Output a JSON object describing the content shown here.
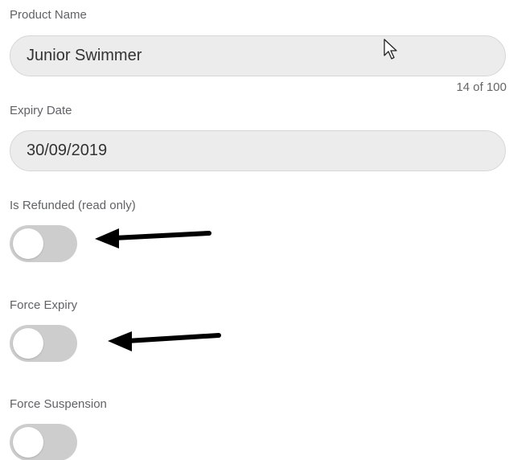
{
  "form": {
    "product_name": {
      "label": "Product Name",
      "value": "Junior Swimmer",
      "counter": "14 of 100"
    },
    "expiry_date": {
      "label": "Expiry Date",
      "value": "30/09/2019"
    },
    "is_refunded": {
      "label": "Is Refunded (read only)",
      "checked": false
    },
    "force_expiry": {
      "label": "Force Expiry",
      "checked": false
    },
    "force_suspension": {
      "label": "Force Suspension",
      "checked": false
    }
  },
  "icons": {
    "cursor": "mouse-pointer-icon",
    "annotation_arrow": "arrow-left-icon"
  },
  "colors": {
    "input_background": "#ececec",
    "toggle_off": "#cdcdcd",
    "label_text": "#5f6368",
    "arrow": "#000000"
  }
}
